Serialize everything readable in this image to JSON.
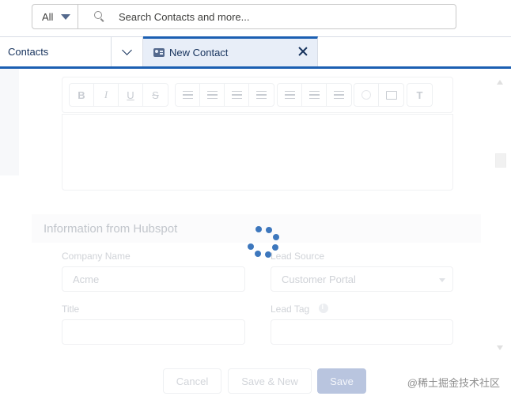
{
  "search": {
    "scope_label": "All",
    "placeholder": "Search Contacts and more..."
  },
  "navigation": {
    "app_name": "Contacts",
    "active_tab": "New Contact"
  },
  "editor": {
    "toolbar": [
      "B",
      "I",
      "U",
      "S",
      "bulleted-list",
      "numbered-list",
      "indent",
      "outdent",
      "align-left",
      "align-center",
      "align-right",
      "link",
      "image",
      "clear-format"
    ]
  },
  "section": {
    "title": "Information from Hubspot",
    "fields": {
      "company_name": {
        "label": "Company Name",
        "value": "Acme"
      },
      "lead_source": {
        "label": "Lead Source",
        "value": "Customer Portal"
      },
      "title": {
        "label": "Title",
        "value": ""
      },
      "lead_tag": {
        "label": "Lead Tag",
        "value": ""
      }
    }
  },
  "buttons": {
    "cancel": "Cancel",
    "save_new": "Save & New",
    "save": "Save"
  },
  "watermark": "@稀土掘金技术社区",
  "colors": {
    "brand": "#1b5fb2",
    "spinner": "#1b5fb2"
  }
}
